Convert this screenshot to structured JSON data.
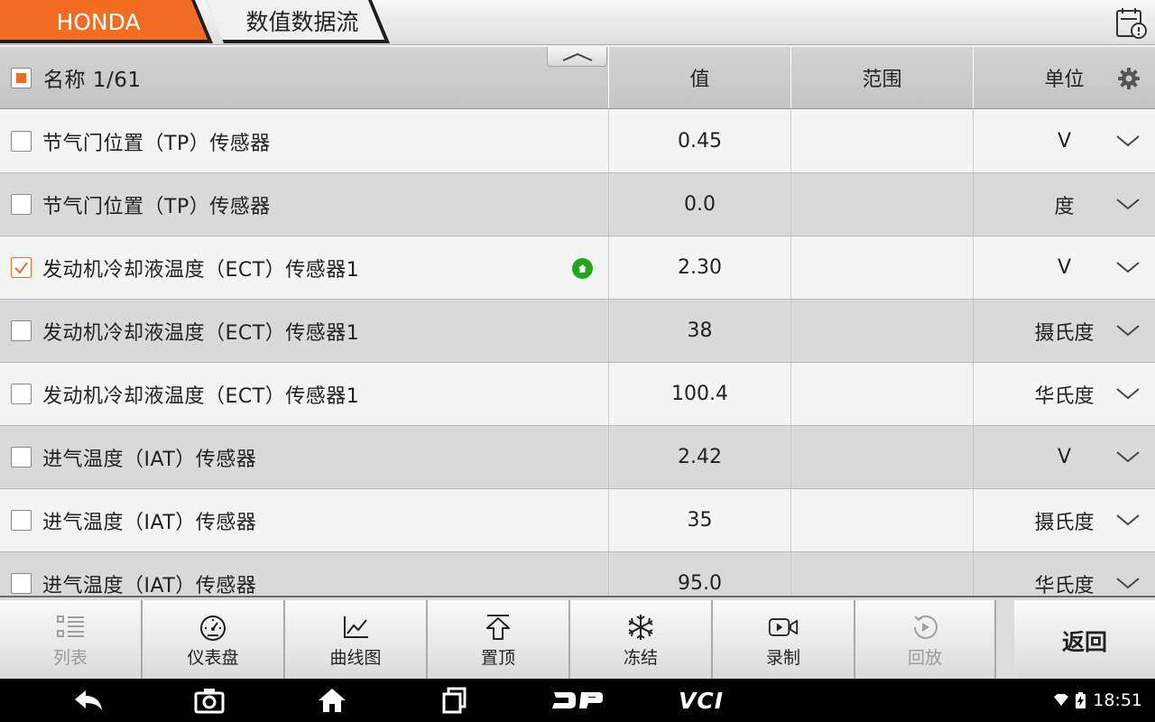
{
  "window": {
    "brand_tab": "HONDA",
    "title_tab": "数值数据流"
  },
  "colors": {
    "accent": "#f26d21",
    "badge_green": "#1ea81e"
  },
  "icons": {
    "report": "report-icon",
    "collapse": "chevron-up-icon",
    "settings": "gear-icon",
    "row_dropdown": "chevron-down-icon",
    "pinned": "home-badge-icon"
  },
  "header": {
    "name_label": "名称 1/61",
    "value_label": "值",
    "range_label": "范围",
    "unit_label": "单位"
  },
  "rows": [
    {
      "name": "节气门位置（TP）传感器",
      "value": "0.45",
      "range": "",
      "unit": "V",
      "checked": false,
      "pinned": false
    },
    {
      "name": "节气门位置（TP）传感器",
      "value": "0.0",
      "range": "",
      "unit": "度",
      "checked": false,
      "pinned": false
    },
    {
      "name": "发动机冷却液温度（ECT）传感器1",
      "value": "2.30",
      "range": "",
      "unit": "V",
      "checked": true,
      "pinned": true
    },
    {
      "name": "发动机冷却液温度（ECT）传感器1",
      "value": "38",
      "range": "",
      "unit": "摄氏度",
      "checked": false,
      "pinned": false
    },
    {
      "name": "发动机冷却液温度（ECT）传感器1",
      "value": "100.4",
      "range": "",
      "unit": "华氏度",
      "checked": false,
      "pinned": false
    },
    {
      "name": "进气温度（IAT）传感器",
      "value": "2.42",
      "range": "",
      "unit": "V",
      "checked": false,
      "pinned": false
    },
    {
      "name": "进气温度（IAT）传感器",
      "value": "35",
      "range": "",
      "unit": "摄氏度",
      "checked": false,
      "pinned": false
    },
    {
      "name": "进气温度（IAT）传感器",
      "value": "95.0",
      "range": "",
      "unit": "华氏度",
      "checked": false,
      "pinned": false
    }
  ],
  "toolbar": {
    "list": "列表",
    "dashboard": "仪表盘",
    "graph": "曲线图",
    "pin_top": "置顶",
    "freeze": "冻结",
    "record": "录制",
    "playback": "回放",
    "back": "返回"
  },
  "navbar": {
    "back_icon": "back-arrow-icon",
    "screenshot_icon": "camera-icon",
    "home_icon": "home-icon",
    "recents_icon": "recents-icon",
    "dp_logo": "DP",
    "vci_logo": "VCI",
    "time": "18:51"
  }
}
